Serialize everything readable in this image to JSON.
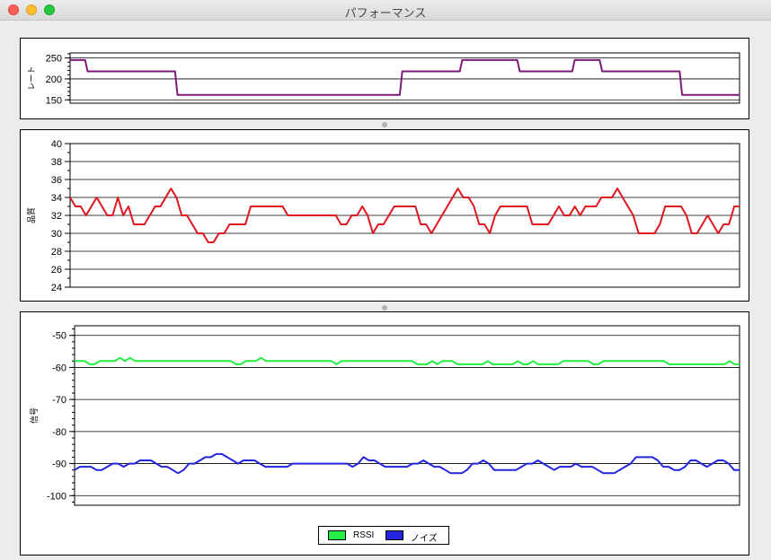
{
  "window": {
    "title": "パフォーマンス"
  },
  "colors": {
    "rate": "#7d1a78",
    "quality": "#e0161e",
    "rssi": "#22ee44",
    "noise": "#2424dd"
  },
  "chart_data": [
    {
      "type": "line",
      "ylabel": "レート",
      "ylim": [
        142,
        262
      ],
      "yticks": [
        150,
        200,
        250
      ],
      "minor_step": 10,
      "series": [
        {
          "color": "#7d1a78",
          "values": [
            245,
            245,
            245,
            245,
            245,
            245,
            245,
            218,
            218,
            218,
            218,
            218,
            218,
            218,
            218,
            218,
            218,
            218,
            218,
            218,
            218,
            218,
            218,
            218,
            218,
            218,
            218,
            218,
            218,
            218,
            218,
            218,
            218,
            218,
            218,
            218,
            218,
            218,
            218,
            218,
            218,
            218,
            218,
            162,
            162,
            162,
            162,
            162,
            162,
            162,
            162,
            162,
            162,
            162,
            162,
            162,
            162,
            162,
            162,
            162,
            162,
            162,
            162,
            162,
            162,
            162,
            162,
            162,
            162,
            162,
            162,
            162,
            162,
            162,
            162,
            162,
            162,
            162,
            162,
            162,
            162,
            162,
            162,
            162,
            162,
            162,
            162,
            162,
            162,
            162,
            162,
            162,
            162,
            162,
            162,
            162,
            162,
            162,
            162,
            162,
            162,
            162,
            162,
            162,
            162,
            162,
            162,
            162,
            162,
            162,
            162,
            162,
            162,
            162,
            162,
            162,
            162,
            162,
            162,
            162,
            162,
            162,
            162,
            162,
            162,
            162,
            162,
            162,
            162,
            162,
            162,
            162,
            162,
            218,
            218,
            218,
            218,
            218,
            218,
            218,
            218,
            218,
            218,
            218,
            218,
            218,
            218,
            218,
            218,
            218,
            218,
            218,
            218,
            218,
            218,
            218,
            218,
            245,
            245,
            245,
            245,
            245,
            245,
            245,
            245,
            245,
            245,
            245,
            245,
            245,
            245,
            245,
            245,
            245,
            245,
            245,
            245,
            245,
            245,
            245,
            218,
            218,
            218,
            218,
            218,
            218,
            218,
            218,
            218,
            218,
            218,
            218,
            218,
            218,
            218,
            218,
            218,
            218,
            218,
            218,
            218,
            218,
            245,
            245,
            245,
            245,
            245,
            245,
            245,
            245,
            245,
            245,
            245,
            218,
            218,
            218,
            218,
            218,
            218,
            218,
            218,
            218,
            218,
            218,
            218,
            218,
            218,
            218,
            218,
            218,
            218,
            218,
            218,
            218,
            218,
            218,
            218,
            218,
            218,
            218,
            218,
            218,
            218,
            218,
            218,
            162,
            162,
            162,
            162,
            162,
            162,
            162,
            162,
            162,
            162,
            162,
            162,
            162,
            162,
            162,
            162,
            162,
            162,
            162,
            162,
            162,
            162,
            162,
            162
          ]
        }
      ]
    },
    {
      "type": "line",
      "ylabel": "品質",
      "ylim": [
        24,
        40
      ],
      "yticks": [
        24,
        26,
        28,
        30,
        32,
        34,
        36,
        38,
        40
      ],
      "minor_step": 1,
      "series": [
        {
          "color": "#e0161e",
          "values": [
            34,
            33,
            33,
            32,
            33,
            34,
            33,
            32,
            32,
            34,
            32,
            33,
            31,
            31,
            31,
            32,
            33,
            33,
            34,
            35,
            34,
            32,
            32,
            31,
            30,
            30,
            29,
            29,
            30,
            30,
            31,
            31,
            31,
            31,
            33,
            33,
            33,
            33,
            33,
            33,
            33,
            32,
            32,
            32,
            32,
            32,
            32,
            32,
            32,
            32,
            32,
            31,
            31,
            32,
            32,
            33,
            32,
            30,
            31,
            31,
            32,
            33,
            33,
            33,
            33,
            33,
            31,
            31,
            30,
            31,
            32,
            33,
            34,
            35,
            34,
            34,
            33,
            31,
            31,
            30,
            32,
            33,
            33,
            33,
            33,
            33,
            33,
            31,
            31,
            31,
            31,
            32,
            33,
            32,
            32,
            33,
            32,
            33,
            33,
            33,
            34,
            34,
            34,
            35,
            34,
            33,
            32,
            30,
            30,
            30,
            30,
            31,
            33,
            33,
            33,
            33,
            32,
            30,
            30,
            31,
            32,
            31,
            30,
            31,
            31,
            33,
            33
          ]
        }
      ]
    },
    {
      "type": "line",
      "ylabel": "信号",
      "ylim": [
        -103,
        -47
      ],
      "yticks": [
        -100,
        -90,
        -80,
        -70,
        -60,
        -50
      ],
      "minor_step": 2,
      "series": [
        {
          "name": "RSSI",
          "color": "#22ee44",
          "values": [
            -58,
            -58,
            -58,
            -59,
            -59,
            -58,
            -58,
            -58,
            -58,
            -57,
            -58,
            -57,
            -58,
            -58,
            -58,
            -58,
            -58,
            -58,
            -58,
            -58,
            -58,
            -58,
            -58,
            -58,
            -58,
            -58,
            -58,
            -58,
            -58,
            -58,
            -58,
            -58,
            -59,
            -59,
            -58,
            -58,
            -58,
            -57,
            -58,
            -58,
            -58,
            -58,
            -58,
            -58,
            -58,
            -58,
            -58,
            -58,
            -58,
            -58,
            -58,
            -58,
            -59,
            -58,
            -58,
            -58,
            -58,
            -58,
            -58,
            -58,
            -58,
            -58,
            -58,
            -58,
            -58,
            -58,
            -58,
            -58,
            -59,
            -59,
            -59,
            -58,
            -59,
            -58,
            -58,
            -58,
            -59,
            -59,
            -59,
            -59,
            -59,
            -59,
            -58,
            -59,
            -59,
            -59,
            -59,
            -59,
            -58,
            -59,
            -59,
            -58,
            -59,
            -59,
            -59,
            -59,
            -59,
            -58,
            -58,
            -58,
            -58,
            -58,
            -58,
            -59,
            -59,
            -58,
            -58,
            -58,
            -58,
            -58,
            -58,
            -58,
            -58,
            -58,
            -58,
            -58,
            -58,
            -58,
            -59,
            -59,
            -59,
            -59,
            -59,
            -59,
            -59,
            -59,
            -59,
            -59,
            -59,
            -59,
            -58,
            -59,
            -59
          ]
        },
        {
          "name": "ノイズ",
          "color": "#2424dd",
          "values": [
            -92,
            -91,
            -91,
            -91,
            -92,
            -92,
            -91,
            -90,
            -90,
            -91,
            -90,
            -90,
            -89,
            -89,
            -89,
            -90,
            -91,
            -91,
            -92,
            -93,
            -92,
            -90,
            -90,
            -89,
            -88,
            -88,
            -87,
            -87,
            -88,
            -89,
            -90,
            -89,
            -89,
            -89,
            -90,
            -91,
            -91,
            -91,
            -91,
            -91,
            -90,
            -90,
            -90,
            -90,
            -90,
            -90,
            -90,
            -90,
            -90,
            -90,
            -90,
            -91,
            -90,
            -88,
            -89,
            -89,
            -90,
            -91,
            -91,
            -91,
            -91,
            -91,
            -90,
            -90,
            -89,
            -90,
            -91,
            -91,
            -92,
            -93,
            -93,
            -93,
            -92,
            -90,
            -90,
            -89,
            -90,
            -92,
            -92,
            -92,
            -92,
            -92,
            -91,
            -90,
            -90,
            -89,
            -90,
            -91,
            -92,
            -91,
            -91,
            -91,
            -90,
            -91,
            -91,
            -91,
            -92,
            -93,
            -93,
            -93,
            -92,
            -91,
            -90,
            -88,
            -88,
            -88,
            -88,
            -89,
            -91,
            -91,
            -92,
            -92,
            -91,
            -89,
            -89,
            -90,
            -91,
            -90,
            -89,
            -89,
            -90,
            -92,
            -92
          ]
        }
      ]
    }
  ]
}
